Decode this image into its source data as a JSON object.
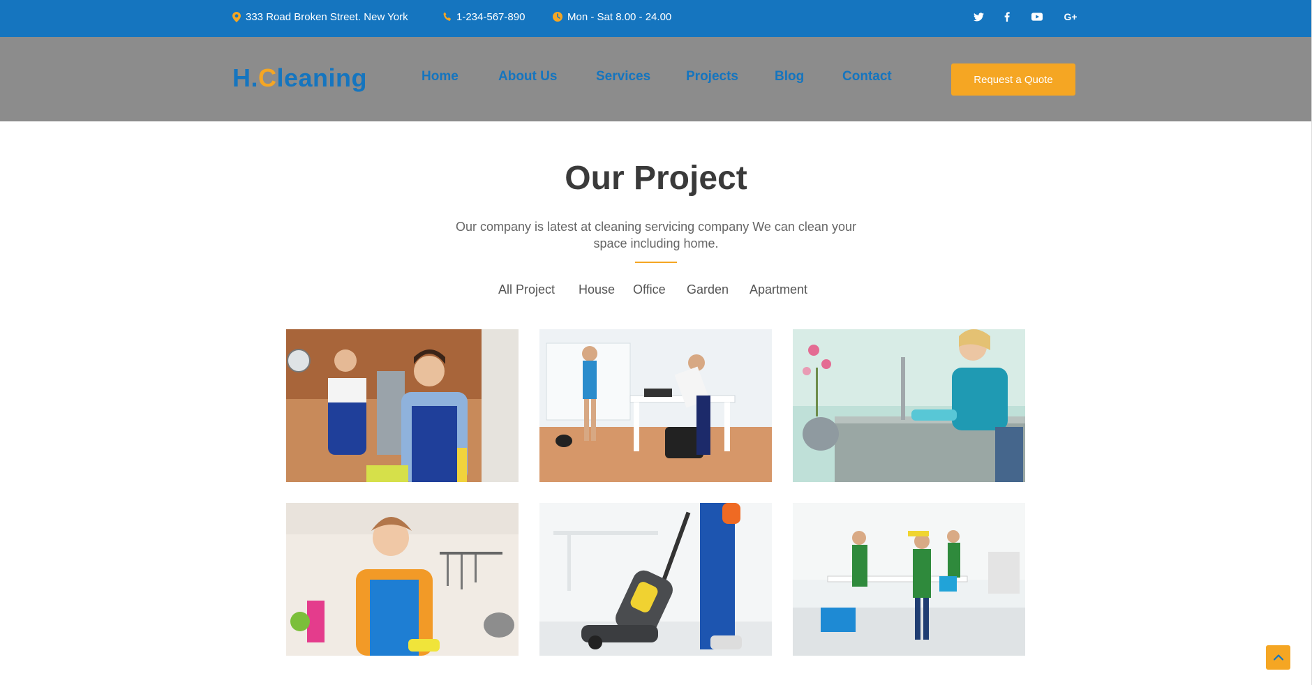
{
  "topbar": {
    "address": "333 Road Broken Street. New York",
    "phone": "1-234-567-890",
    "hours": "Mon - Sat 8.00 - 24.00",
    "address_icon": "map-pin-icon",
    "phone_icon": "phone-icon",
    "hours_icon": "clock-icon",
    "social": [
      "twitter-icon",
      "facebook-icon",
      "youtube-icon",
      "google-plus-icon"
    ],
    "google_plus_label": "G+"
  },
  "header": {
    "logo_prefix": "H.",
    "logo_c": "C",
    "logo_rest": "leaning",
    "nav": [
      "Home",
      "About Us",
      "Services",
      "Projects",
      "Blog",
      "Contact"
    ],
    "cta_label": "Request a Quote"
  },
  "projects": {
    "title": "Our Project",
    "subtitle": "Our company is latest at cleaning servicing company We can clean your space including home.",
    "filters": [
      "All Project",
      "House",
      "Office",
      "Garden",
      "Apartment"
    ]
  },
  "colors": {
    "brand_blue": "#1575bf",
    "accent_orange": "#f5a623",
    "header_gray": "#8c8c8c"
  },
  "back_to_top_icon": "chevron-up-icon"
}
